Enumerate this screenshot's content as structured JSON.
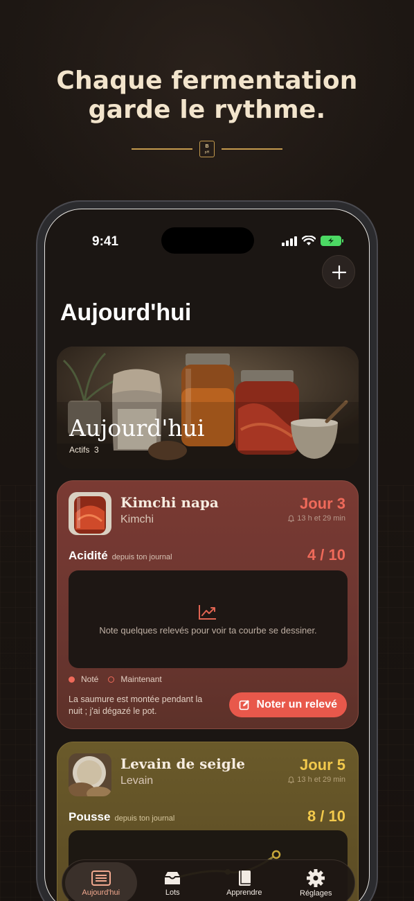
{
  "marketing": {
    "headline_line1": "Chaque fermentation",
    "headline_line2": "garde le rythme.",
    "badge_top": "B",
    "badge_bottom": "pH"
  },
  "status_bar": {
    "time": "9:41"
  },
  "header": {
    "title": "Aujourd'hui",
    "add_icon": "plus-icon"
  },
  "hero": {
    "title": "Aujourd'hui",
    "active_label": "Actifs",
    "active_count": "3"
  },
  "batches": [
    {
      "name": "Kimchi napa",
      "type": "Kimchi",
      "day": "Jour 3",
      "timer": "13 h et 29 min",
      "metric": "Acidité",
      "metric_source": "depuis ton journal",
      "score": "4 / 10",
      "empty_text": "Note quelques relevés pour voir ta courbe se dessiner.",
      "legend_noted": "Noté",
      "legend_now": "Maintenant",
      "note": "La saumure est montée pendant la nuit ; j'ai dégazé le pot.",
      "cta": "Noter un relevé",
      "accent": "#ef6a5a"
    },
    {
      "name": "Levain de seigle",
      "type": "Levain",
      "day": "Jour 5",
      "timer": "13 h et 29 min",
      "metric": "Pousse",
      "metric_source": "depuis ton journal",
      "score": "8 / 10",
      "accent": "#f2c94c"
    }
  ],
  "tabbar": {
    "tabs": [
      {
        "label": "Aujourd'hui",
        "icon": "list-icon",
        "active": true
      },
      {
        "label": "Lots",
        "icon": "tray-icon",
        "active": false
      },
      {
        "label": "Apprendre",
        "icon": "book-icon",
        "active": false
      },
      {
        "label": "Réglages",
        "icon": "gear-icon",
        "active": false
      }
    ]
  }
}
